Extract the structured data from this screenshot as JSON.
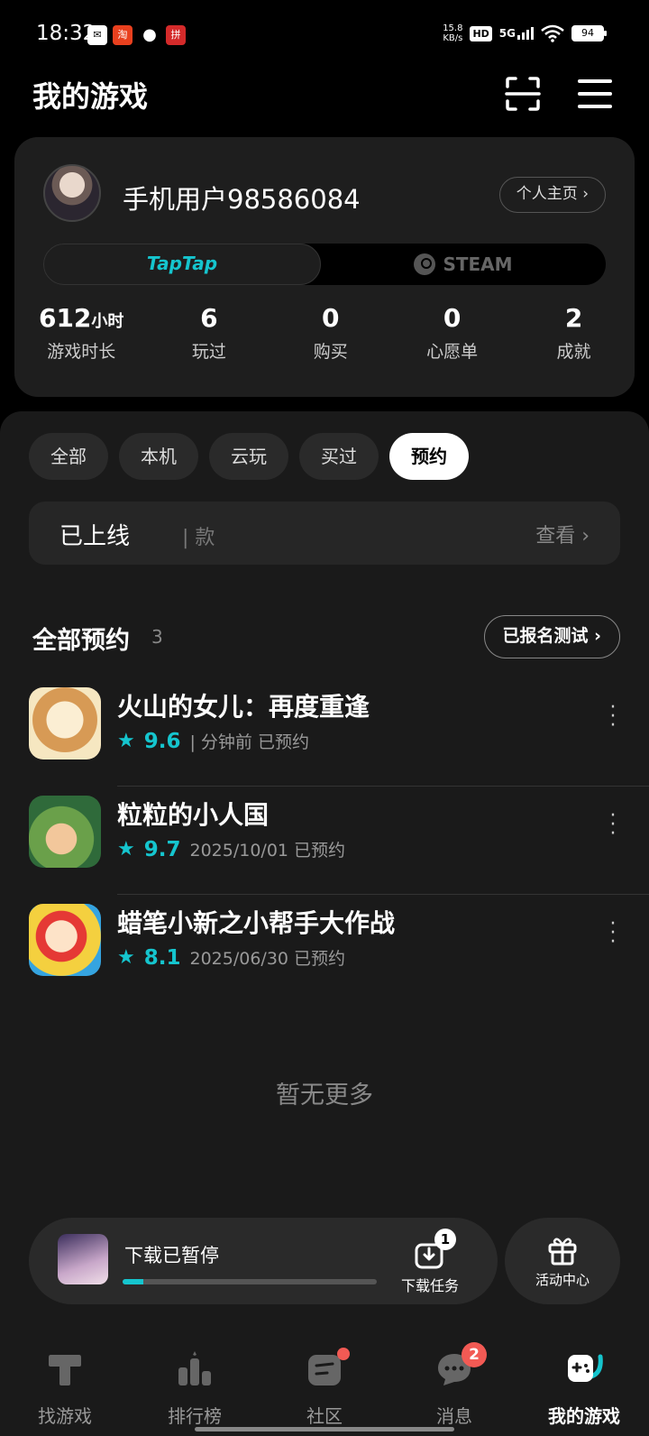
{
  "status_bar": {
    "time": "18:32",
    "net_speed_value": "15.8",
    "net_speed_unit": "KB/s",
    "hd": "HD",
    "network": "5G",
    "battery": "94"
  },
  "header": {
    "title": "我的游戏",
    "scan_icon": "scan-icon",
    "menu_icon": "menu-icon"
  },
  "profile": {
    "username": "手机用户98586084",
    "profile_link": "个人主页 ›",
    "platforms": {
      "taptap": "TapTap",
      "steam": "STEAM"
    },
    "stats": [
      {
        "value": "612",
        "unit": "小时",
        "label": "游戏时长"
      },
      {
        "value": "6",
        "unit": "",
        "label": "玩过"
      },
      {
        "value": "0",
        "unit": "",
        "label": "购买"
      },
      {
        "value": "0",
        "unit": "",
        "label": "心愿单"
      },
      {
        "value": "2",
        "unit": "",
        "label": "成就"
      }
    ]
  },
  "filters": [
    "全部",
    "本机",
    "云玩",
    "买过",
    "预约"
  ],
  "active_filter": "预约",
  "online": {
    "label": "已上线",
    "count": "| 款",
    "view": "查看 ›"
  },
  "section": {
    "title": "全部预约",
    "count": "3",
    "signup_button": "已报名测试 ›"
  },
  "games": [
    {
      "name": "火山的女儿：再度重逢",
      "rating": "9.6",
      "status": "| 分钟前 已预约",
      "icon_colors": [
        "#f6e7c1",
        "#c98a45"
      ]
    },
    {
      "name": "粒粒的小人国",
      "rating": "9.7",
      "status": "2025/10/01 已预约",
      "icon_colors": [
        "#6aa04a",
        "#f0b27a"
      ]
    },
    {
      "name": "蜡笔小新之小帮手大作战",
      "rating": "8.1",
      "status": "2025/06/30 已预约",
      "icon_colors": [
        "#35a4e0",
        "#f4d03f"
      ]
    }
  ],
  "no_more": "暂无更多",
  "download": {
    "status": "下载已暂停",
    "progress": 0.08,
    "tasks_label": "下载任务",
    "tasks_count": "1"
  },
  "activity": {
    "label": "活动中心"
  },
  "nav": [
    {
      "label": "找游戏",
      "icon": "find-games-icon"
    },
    {
      "label": "排行榜",
      "icon": "ranking-icon"
    },
    {
      "label": "社区",
      "icon": "community-icon"
    },
    {
      "label": "消息",
      "icon": "message-icon",
      "badge": "2"
    },
    {
      "label": "我的游戏",
      "icon": "my-games-icon"
    }
  ],
  "colors": {
    "accent": "#15c5ce",
    "badge": "#f25a54",
    "background": "#000000",
    "panel": "#1a1a1a"
  }
}
